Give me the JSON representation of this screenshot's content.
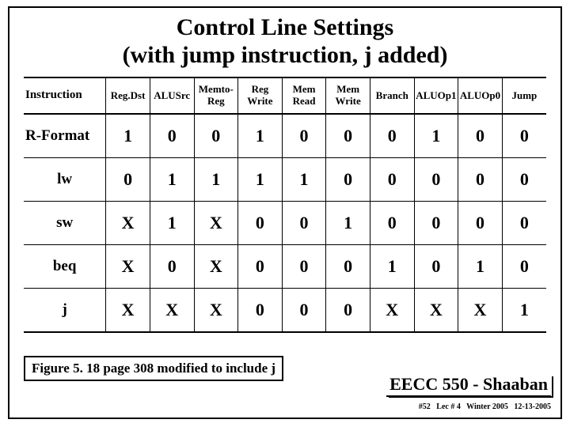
{
  "title_line1": "Control Line Settings",
  "title_line2": "(with jump instruction, j added)",
  "columns": [
    "Instruction",
    "Reg.Dst",
    "ALUSrc",
    "Memto-\nReg",
    "Reg\nWrite",
    "Mem\nRead",
    "Mem\nWrite",
    "Branch",
    "ALUOp1",
    "ALUOp0",
    "Jump"
  ],
  "rows": [
    {
      "label": "R-Format",
      "cells": [
        "1",
        "0",
        "0",
        "1",
        "0",
        "0",
        "0",
        "1",
        "0",
        "0"
      ]
    },
    {
      "label": "lw",
      "cells": [
        "0",
        "1",
        "1",
        "1",
        "1",
        "0",
        "0",
        "0",
        "0",
        "0"
      ]
    },
    {
      "label": "sw",
      "cells": [
        "X",
        "1",
        "X",
        "0",
        "0",
        "1",
        "0",
        "0",
        "0",
        "0"
      ]
    },
    {
      "label": "beq",
      "cells": [
        "X",
        "0",
        "X",
        "0",
        "0",
        "0",
        "1",
        "0",
        "1",
        "0"
      ]
    },
    {
      "label": "j",
      "cells": [
        "X",
        "X",
        "X",
        "0",
        "0",
        "0",
        "X",
        "X",
        "X",
        "1"
      ]
    }
  ],
  "figure_caption": "Figure 5. 18 page 308 modified to include j",
  "course": "EECC 550 - Shaaban",
  "meta": "#52   Lec # 4   Winter 2005   12-13-2005",
  "chart_data": {
    "type": "table",
    "title": "Control Line Settings (with jump instruction, j added)",
    "columns": [
      "Instruction",
      "Reg.Dst",
      "ALUSrc",
      "Memto-Reg",
      "RegWrite",
      "MemRead",
      "MemWrite",
      "Branch",
      "ALUOp1",
      "ALUOp0",
      "Jump"
    ],
    "rows": [
      [
        "R-Format",
        "1",
        "0",
        "0",
        "1",
        "0",
        "0",
        "0",
        "1",
        "0",
        "0"
      ],
      [
        "lw",
        "0",
        "1",
        "1",
        "1",
        "1",
        "0",
        "0",
        "0",
        "0",
        "0"
      ],
      [
        "sw",
        "X",
        "1",
        "X",
        "0",
        "0",
        "1",
        "0",
        "0",
        "0",
        "0"
      ],
      [
        "beq",
        "X",
        "0",
        "X",
        "0",
        "0",
        "0",
        "1",
        "0",
        "1",
        "0"
      ],
      [
        "j",
        "X",
        "X",
        "X",
        "0",
        "0",
        "0",
        "X",
        "X",
        "X",
        "1"
      ]
    ]
  }
}
